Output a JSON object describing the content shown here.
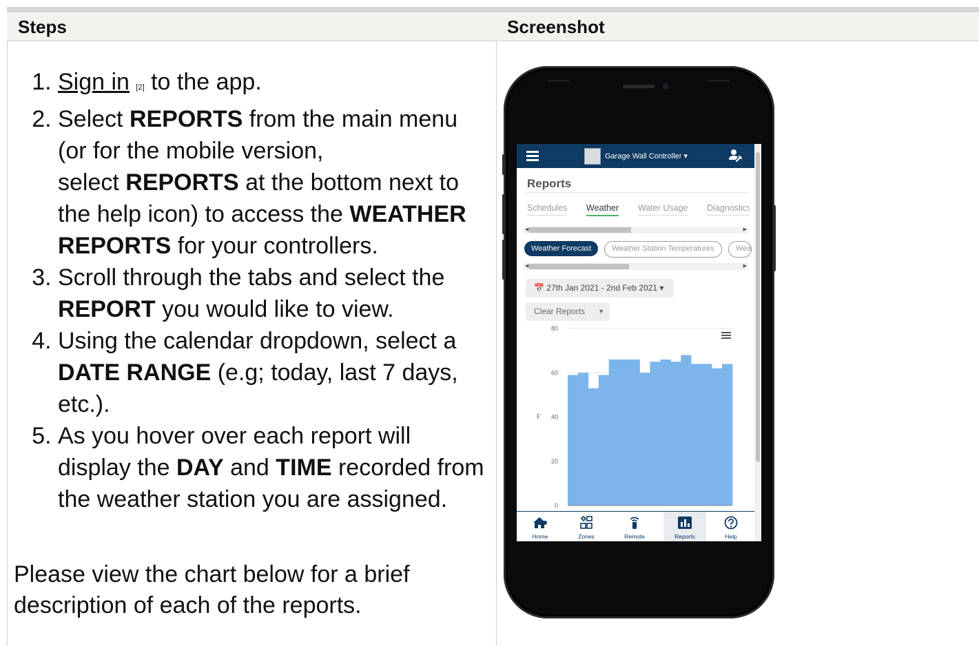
{
  "table": {
    "header_steps": "Steps",
    "header_screenshot": "Screenshot"
  },
  "steps": {
    "s1_link": "Sign in",
    "s1_ref": "[2]",
    "s1_rest": " to the app.",
    "s2_a": "Select ",
    "s2_b": "REPORTS",
    "s2_c": " from the main menu (or for the mobile version, ",
    "s2_d": "select ",
    "s2_e": "REPORTS",
    "s2_f": " at the bottom next to the help icon) to access the ",
    "s2_g": "WEATHER REPORTS",
    "s2_h": " for your controllers.",
    "s3_a": "Scroll through the tabs and select the ",
    "s3_b": "REPORT",
    "s3_c": " you would like to view.",
    "s4_a": "Using the calendar dropdown, select a ",
    "s4_b": "DATE RANGE",
    "s4_c": " (e.g; today, last 7 days, etc.).",
    "s5_a": "As you hover over each report will display the ",
    "s5_b": "DAY",
    "s5_c": " and ",
    "s5_d": "TIME",
    "s5_e": " recorded from the weather station you are assigned."
  },
  "note": "Please view the chart below for a brief description of each of the reports.",
  "app": {
    "controller_name": "Garage Wall Controller ▾",
    "page_title": "Reports",
    "tabs": [
      {
        "label": "Schedules",
        "active": false
      },
      {
        "label": "Weather",
        "active": true
      },
      {
        "label": "Water Usage",
        "active": false
      },
      {
        "label": "Diagnostics",
        "active": false
      }
    ],
    "pills": [
      {
        "label": "Weather Forecast",
        "active": true
      },
      {
        "label": "Weather Station Temperatures",
        "active": false
      },
      {
        "label": "Wea",
        "active": false
      }
    ],
    "date_range": "📅 27th Jan 2021 - 2nd Feb 2021 ▾",
    "clear_reports": "Clear Reports",
    "nav": [
      {
        "label": "Home",
        "icon": "home-icon"
      },
      {
        "label": "Zones",
        "icon": "zones-icon"
      },
      {
        "label": "Remote",
        "icon": "remote-icon"
      },
      {
        "label": "Reports",
        "icon": "reports-icon",
        "active": true
      },
      {
        "label": "Help",
        "icon": "help-icon"
      }
    ],
    "accent_color": "#0e3a63",
    "bar_color": "#7cb5ec",
    "tab_underline_color": "#46b95a"
  },
  "chart_data": {
    "type": "bar",
    "ylabel": "F",
    "ylim": [
      0,
      80
    ],
    "yticks": [
      0,
      20,
      40,
      60,
      80
    ],
    "values": [
      59,
      60,
      53,
      59,
      66,
      66,
      66,
      60,
      65,
      66,
      65,
      68,
      64,
      64,
      62,
      64
    ],
    "grid": true
  }
}
